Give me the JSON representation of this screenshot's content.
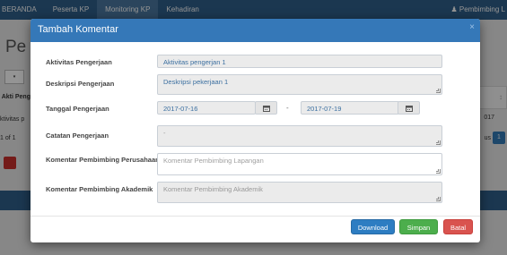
{
  "nav": {
    "items": [
      "BERANDA",
      "Peserta KP",
      "Monitoring KP",
      "Kehadiran"
    ],
    "user": "Pembimbing L"
  },
  "background": {
    "page_title": "Pe",
    "select_value": "▾",
    "col_head": "Akti Peng",
    "cell_text": "ktivitas p",
    "info_text": "1 of 1",
    "right_year": "017",
    "right_info": "us",
    "page_num": "1"
  },
  "modal": {
    "title": "Tambah Komentar",
    "close": "×",
    "labels": {
      "aktivitas": "Aktivitas Pengerjaan",
      "deskripsi": "Deskripsi Pengerjaan",
      "tanggal": "Tanggal Pengerjaan",
      "catatan": "Catatan Pengerjaan",
      "kom_perusahaan": "Komentar Pembimbing Perusahaan",
      "kom_akademik": "Komentar Pembimbing Akademik"
    },
    "values": {
      "aktivitas": "Aktivitas pengerjan 1",
      "deskripsi": "Deskripsi pekerjaan 1",
      "tanggal_mulai": "2017-07-16",
      "tanggal_selesai": "2017-07-19",
      "range_separator": "-",
      "catatan": "-"
    },
    "placeholders": {
      "kom_perusahaan": "Komentar Pembimbing Lapangan",
      "kom_akademik": "Komentar Pembimbing Akademik"
    },
    "buttons": {
      "download": "Download",
      "simpan": "Simpan",
      "batal": "Batal"
    }
  },
  "colors": {
    "header": "#3578b8",
    "download": "#2d7dc2",
    "simpan": "#4cae4c",
    "batal": "#d9534f"
  },
  "icons": [
    "calendar-icon",
    "user-icon",
    "close-icon"
  ]
}
